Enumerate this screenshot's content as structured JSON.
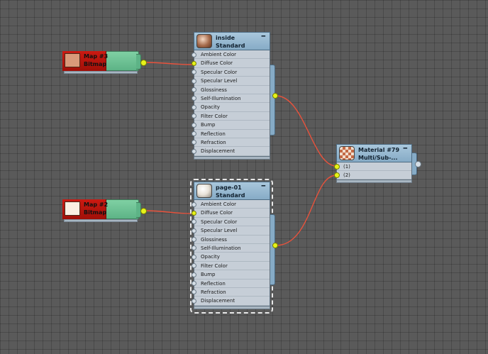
{
  "bitmap_nodes": [
    {
      "id": "map3",
      "title": "Map #3",
      "subtitle": "Bitmap",
      "thumb_color": "#d99a7a"
    },
    {
      "id": "map2",
      "title": "Map #2",
      "subtitle": "Bitmap",
      "thumb_color": "#fbf0e2"
    }
  ],
  "material_nodes": [
    {
      "id": "inside",
      "name": "inside",
      "type": "Standard",
      "collapse_label": "━",
      "thumb_colors": [
        "#f5d8c3",
        "#a46a4b",
        "#5a3322"
      ],
      "slots": [
        "Ambient Color",
        "Diffuse Color",
        "Specular Color",
        "Specular Level",
        "Glossiness",
        "Self-Illumination",
        "Opacity",
        "Filter Color",
        "Bump",
        "Reflection",
        "Refraction",
        "Displacement"
      ],
      "connected_slot": "Diffuse Color"
    },
    {
      "id": "page01",
      "name": "page-01",
      "type": "Standard",
      "collapse_label": "━",
      "thumb_colors": [
        "#ffffff",
        "#e8e2d8",
        "#8a857c"
      ],
      "slots": [
        "Ambient Color",
        "Diffuse Color",
        "Specular Color",
        "Specular Level",
        "Glossiness",
        "Self-Illumination",
        "Opacity",
        "Filter Color",
        "Bump",
        "Reflection",
        "Refraction",
        "Displacement"
      ],
      "connected_slot": "Diffuse Color",
      "selected": true
    }
  ],
  "multi_node": {
    "name": "Material #79",
    "type": "Multi/Sub-...",
    "collapse_label": "━",
    "slots": [
      "(1)",
      "(2)"
    ]
  },
  "wire_color": "#e8523c",
  "socket_color": "#e6f21a"
}
